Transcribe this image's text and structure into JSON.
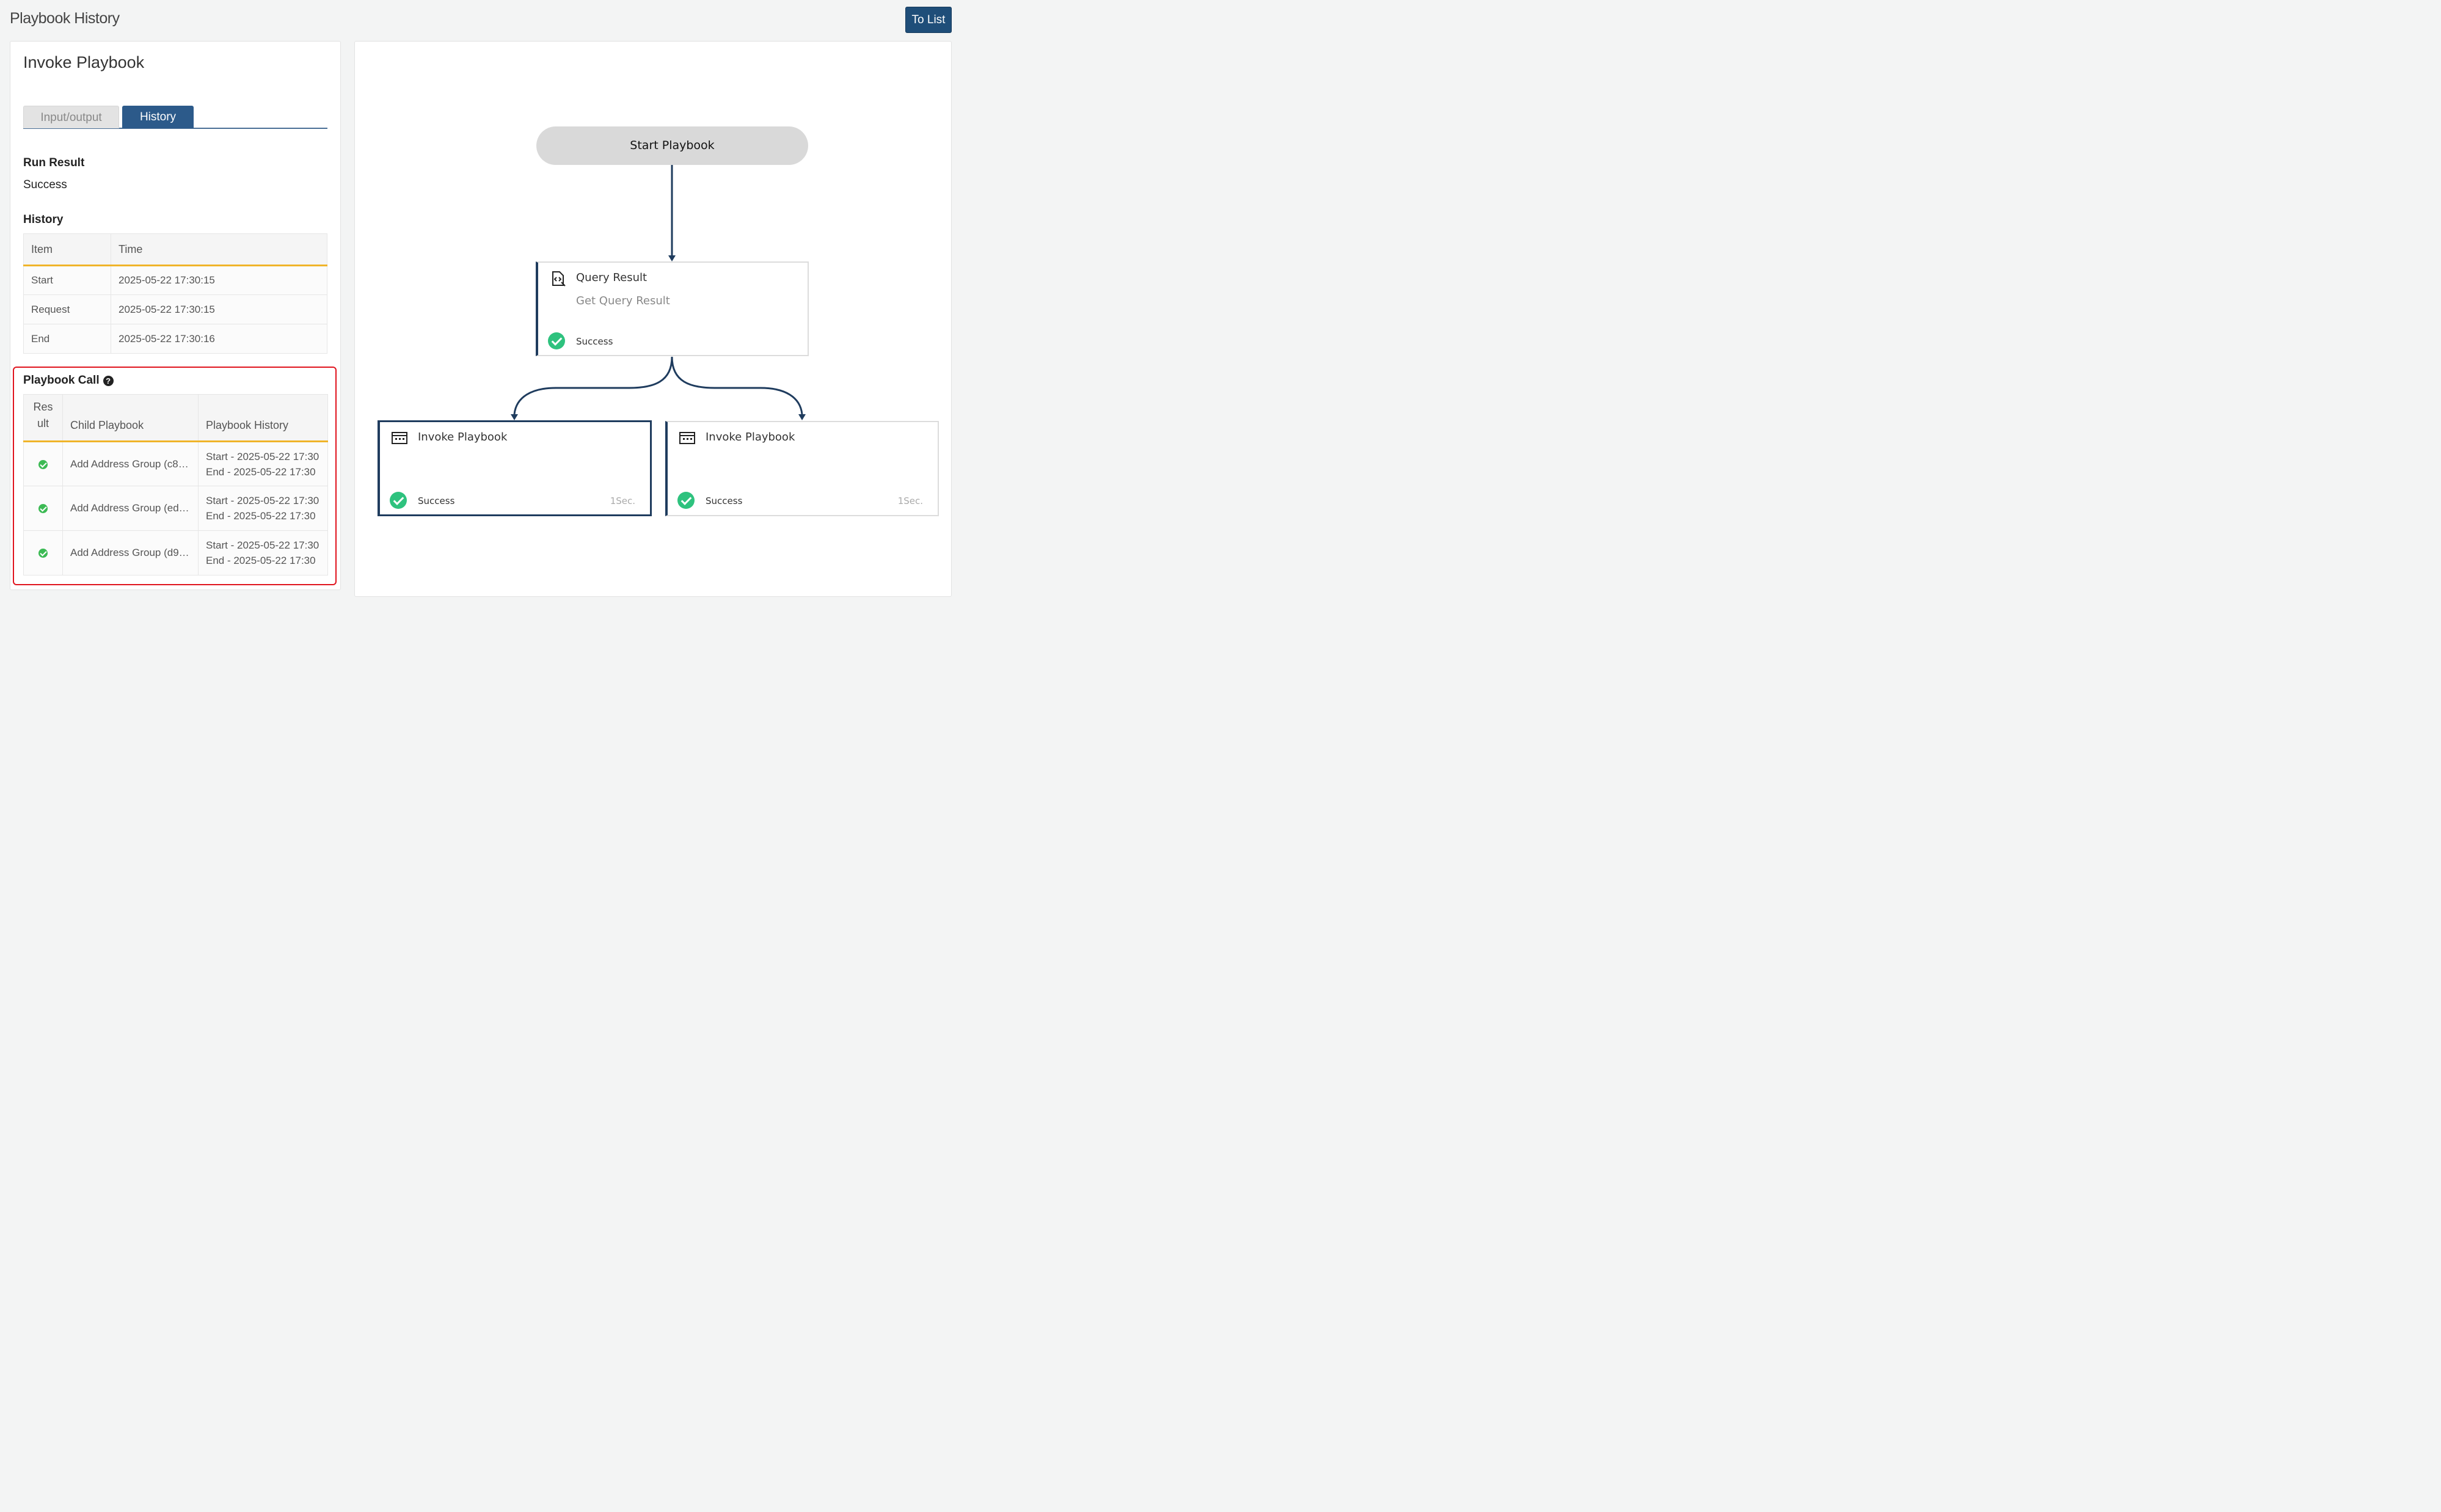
{
  "header": {
    "title": "Playbook History",
    "to_list_label": "To List"
  },
  "left": {
    "title": "Invoke Playbook",
    "tabs": [
      "Input/output",
      "History"
    ],
    "run_result_label": "Run Result",
    "run_result_value": "Success",
    "history_label": "History",
    "history_table": {
      "columns": [
        "Item",
        "Time"
      ],
      "rows": [
        {
          "item": "Start",
          "time": "2025-05-22 17:30:15"
        },
        {
          "item": "Request",
          "time": "2025-05-22 17:30:15"
        },
        {
          "item": "End",
          "time": "2025-05-22 17:30:16"
        }
      ]
    },
    "playbook_call_label": "Playbook Call",
    "call_table": {
      "columns": {
        "result_line1": "Res",
        "result_line2": "ult",
        "child": "Child Playbook",
        "history": "Playbook History"
      },
      "rows": [
        {
          "child": "Add Address Group (c8…",
          "start": "Start - 2025-05-22 17:30",
          "end": "End - 2025-05-22 17:30"
        },
        {
          "child": "Add Address Group (ed…",
          "start": "Start - 2025-05-22 17:30",
          "end": "End - 2025-05-22 17:30"
        },
        {
          "child": "Add Address Group (d9…",
          "start": "Start - 2025-05-22 17:30",
          "end": "End - 2025-05-22 17:30"
        }
      ]
    }
  },
  "flow": {
    "start_label": "Start Playbook",
    "query_node": {
      "title": "Query Result",
      "subtitle": "Get Query Result",
      "status": "Success"
    },
    "invoke_nodes": [
      {
        "title": "Invoke Playbook",
        "status": "Success",
        "duration": "1Sec."
      },
      {
        "title": "Invoke Playbook",
        "status": "Success",
        "duration": "1Sec."
      }
    ]
  },
  "colors": {
    "accent": "#1f4e79",
    "highlight": "#e0141e",
    "success": "#2ec27e",
    "table_rule": "#f0b429"
  }
}
